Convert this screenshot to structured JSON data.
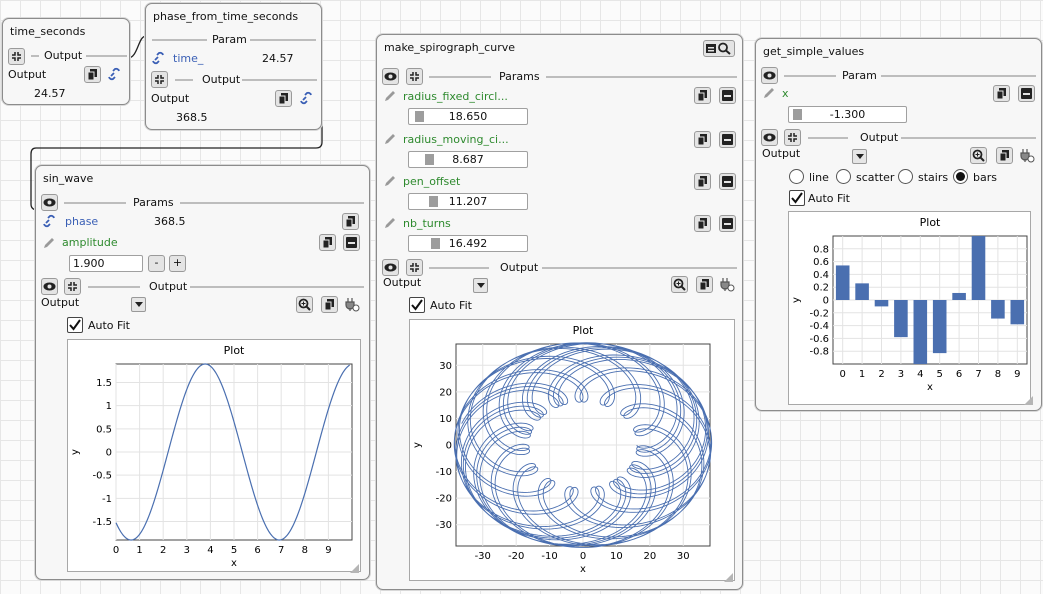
{
  "nodes": {
    "time_seconds": {
      "title": "time_seconds",
      "output_sep": "Output",
      "output_label": "Output",
      "value": "24.57"
    },
    "phase": {
      "title": "phase_from_time_seconds",
      "param_sep": "Param",
      "param_name": "time_",
      "param_value": "24.57",
      "output_sep": "Output",
      "output_label": "Output",
      "value": "368.5"
    },
    "sin": {
      "title": "sin_wave",
      "params_sep": "Params",
      "phase_name": "phase",
      "phase_value": "368.5",
      "amp_name": "amplitude",
      "amp_value": "1.900",
      "minus": "-",
      "plus": "+",
      "output_sep": "Output",
      "output_label": "Output",
      "autofit": "Auto Fit"
    },
    "spiro": {
      "title": "make_spirograph_curve",
      "params_sep": "Params",
      "params": [
        {
          "name": "radius_fixed_circl...",
          "value": "18.650"
        },
        {
          "name": "radius_moving_ci...",
          "value": "8.687"
        },
        {
          "name": "pen_offset",
          "value": "11.207"
        },
        {
          "name": "nb_turns",
          "value": "16.492"
        }
      ],
      "output_sep": "Output",
      "output_label": "Output",
      "autofit": "Auto Fit"
    },
    "simple": {
      "title": "get_simple_values",
      "param_sep": "Param",
      "param_name": "x",
      "param_value": "-1.300",
      "output_sep": "Output",
      "output_label": "Output",
      "styles": [
        "line",
        "scatter",
        "stairs",
        "bars"
      ],
      "selected_style": "bars",
      "autofit": "Auto Fit"
    }
  },
  "icons": {
    "eye": "eye-icon",
    "collapse": "collapse-icon",
    "copy": "copy-icon",
    "link": "link-icon",
    "edit": "pencil-icon",
    "minus": "minus-icon",
    "zoom": "zoom-icon",
    "plug": "plug-icon"
  },
  "colors": {
    "accent": "#4a6fb0",
    "param_green": "#2e8a2e",
    "link_blue": "#3a5fb5"
  },
  "chart_data": [
    {
      "type": "line",
      "title": "Plot",
      "xlabel": "x",
      "ylabel": "y",
      "xlim": [
        0,
        10
      ],
      "ylim": [
        -1.9,
        1.9
      ],
      "xticks": [
        0,
        1,
        2,
        3,
        4,
        5,
        6,
        7,
        8,
        9
      ],
      "yticks": [
        1.5,
        1,
        0.5,
        0,
        -0.5,
        -1,
        -1.5
      ],
      "function": "1.9*sin(x + 368.5)",
      "x_start": 0,
      "x_end": 9.9,
      "grid": true
    },
    {
      "type": "line",
      "title": "Plot",
      "xlabel": "x",
      "ylabel": "y",
      "xlim": [
        -38,
        38
      ],
      "ylim": [
        -38,
        38
      ],
      "xticks": [
        -30,
        -20,
        -10,
        0,
        10,
        20,
        30
      ],
      "yticks": [
        30,
        20,
        10,
        0,
        -10,
        -20,
        -30
      ],
      "curve": "spirograph",
      "radius_fixed": 18.65,
      "radius_moving": 8.687,
      "pen_offset": 11.207,
      "nb_turns": 16.492,
      "grid": true
    },
    {
      "type": "bar",
      "title": "Plot",
      "xlabel": "x",
      "ylabel": "y",
      "ylim": [
        -1,
        1
      ],
      "categories": [
        0,
        1,
        2,
        3,
        4,
        5,
        6,
        7,
        8,
        9
      ],
      "values": [
        0.54,
        0.26,
        -0.1,
        -0.58,
        -1,
        -0.83,
        0.11,
        1,
        -0.29,
        -0.38
      ],
      "yticks": [
        0.8,
        0.6,
        0.4,
        0.2,
        0,
        -0.2,
        -0.4,
        -0.6,
        -0.8
      ],
      "grid": true
    }
  ]
}
